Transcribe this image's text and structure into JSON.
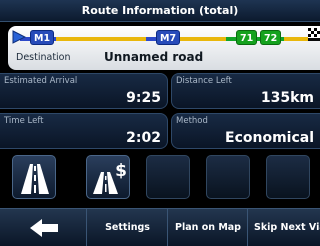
{
  "title": "Route Information (total)",
  "route": {
    "label": "Destination",
    "road_name": "Unnamed road",
    "start_icon": "route-start-flag-icon",
    "finish_icon": "checkered-flag-icon",
    "badges": [
      {
        "text": "M1",
        "style": "blue"
      },
      {
        "text": "M7",
        "style": "blue"
      },
      {
        "text": "71",
        "style": "green"
      },
      {
        "text": "72",
        "style": "green"
      }
    ],
    "line_colors": {
      "motorway": "#2d49c8",
      "trunk": "#12a327",
      "other": "#e9b70b"
    }
  },
  "info": {
    "arrival": {
      "label": "Estimated Arrival",
      "value": "9:25"
    },
    "distance": {
      "label": "Distance Left",
      "value": "135km"
    },
    "time": {
      "label": "Time Left",
      "value": "2:02"
    },
    "method": {
      "label": "Method",
      "value": "Economical"
    }
  },
  "options": [
    {
      "icon": "motorway-icon",
      "active": true
    },
    {
      "icon": "toll-road-icon",
      "active": true
    },
    {
      "icon": "",
      "active": false
    },
    {
      "icon": "",
      "active": false
    },
    {
      "icon": "",
      "active": false
    }
  ],
  "bottom": {
    "back_icon": "back-arrow-icon",
    "settings": "Settings",
    "plan_on_map": "Plan on Map",
    "skip_next": "Skip Next Via"
  },
  "colors": {
    "panel": "#0c1a2e",
    "accent": "#274bb9"
  }
}
